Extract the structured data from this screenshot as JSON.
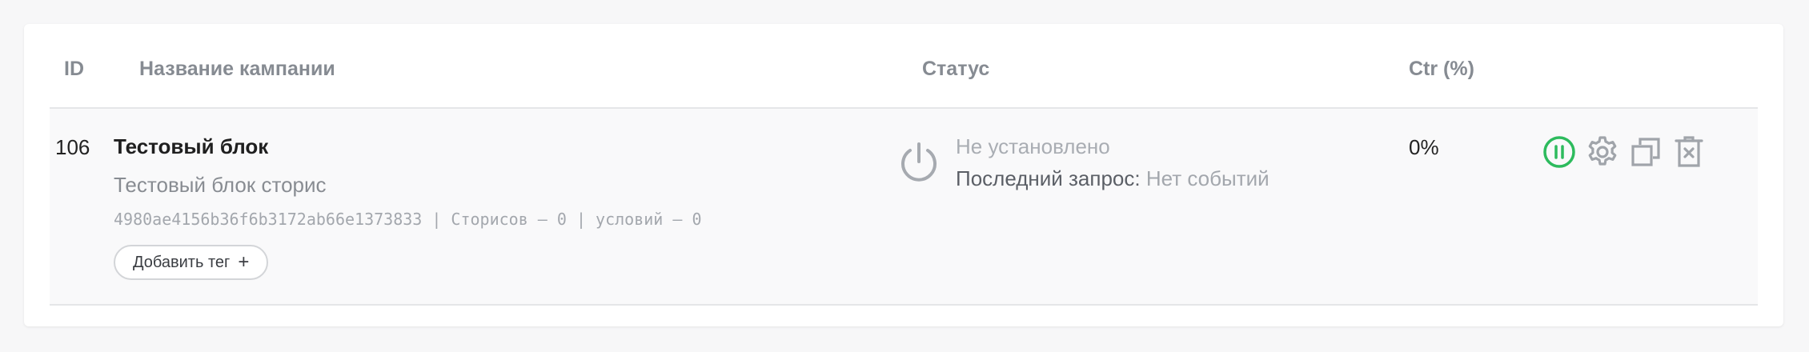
{
  "table": {
    "headers": {
      "id": "ID",
      "name": "Название кампании",
      "status": "Статус",
      "ctr": "Ctr (%)"
    },
    "rows": [
      {
        "id": "106",
        "title": "Тестовый блок",
        "subtitle": "Тестовый блок сторис",
        "meta": "4980ae4156b36f6b3172ab66e1373833 | Сторисов — 0 | условий — 0",
        "add_tag_label": "Добавить тег",
        "status": "Не установлено",
        "last_request_label": "Последний запрос:",
        "last_request_value": "Нет событий",
        "ctr": "0%",
        "actions": [
          "pause-icon",
          "gear-icon",
          "copy-icon",
          "delete-icon"
        ]
      }
    ]
  },
  "colors": {
    "pause_green": "#2dbb5d",
    "icon_gray": "#a0a4aa",
    "header_text": "#868b92"
  }
}
